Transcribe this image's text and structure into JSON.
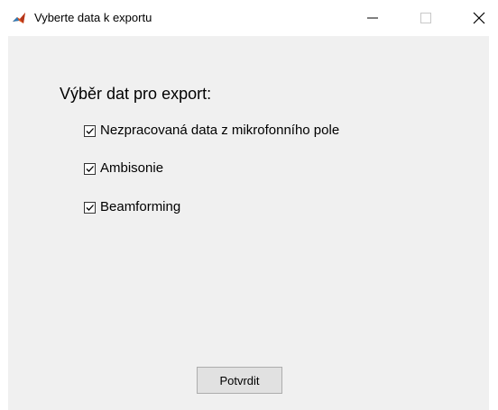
{
  "window": {
    "title": "Vyberte data k exportu",
    "icon": "matlab-icon",
    "controls": {
      "minimize": "minimize-icon",
      "maximize": "maximize-icon",
      "close": "close-icon"
    }
  },
  "dialog": {
    "heading": "Výběr dat pro export:",
    "options": [
      {
        "label": "Nezpracovaná data z mikrofonního pole",
        "checked": true
      },
      {
        "label": "Ambisonie",
        "checked": true
      },
      {
        "label": "Beamforming",
        "checked": true
      }
    ],
    "confirm_label": "Potvrdit"
  },
  "colors": {
    "background": "#f0f0f0",
    "button_face": "#e1e1e1",
    "button_border": "#adadad"
  }
}
